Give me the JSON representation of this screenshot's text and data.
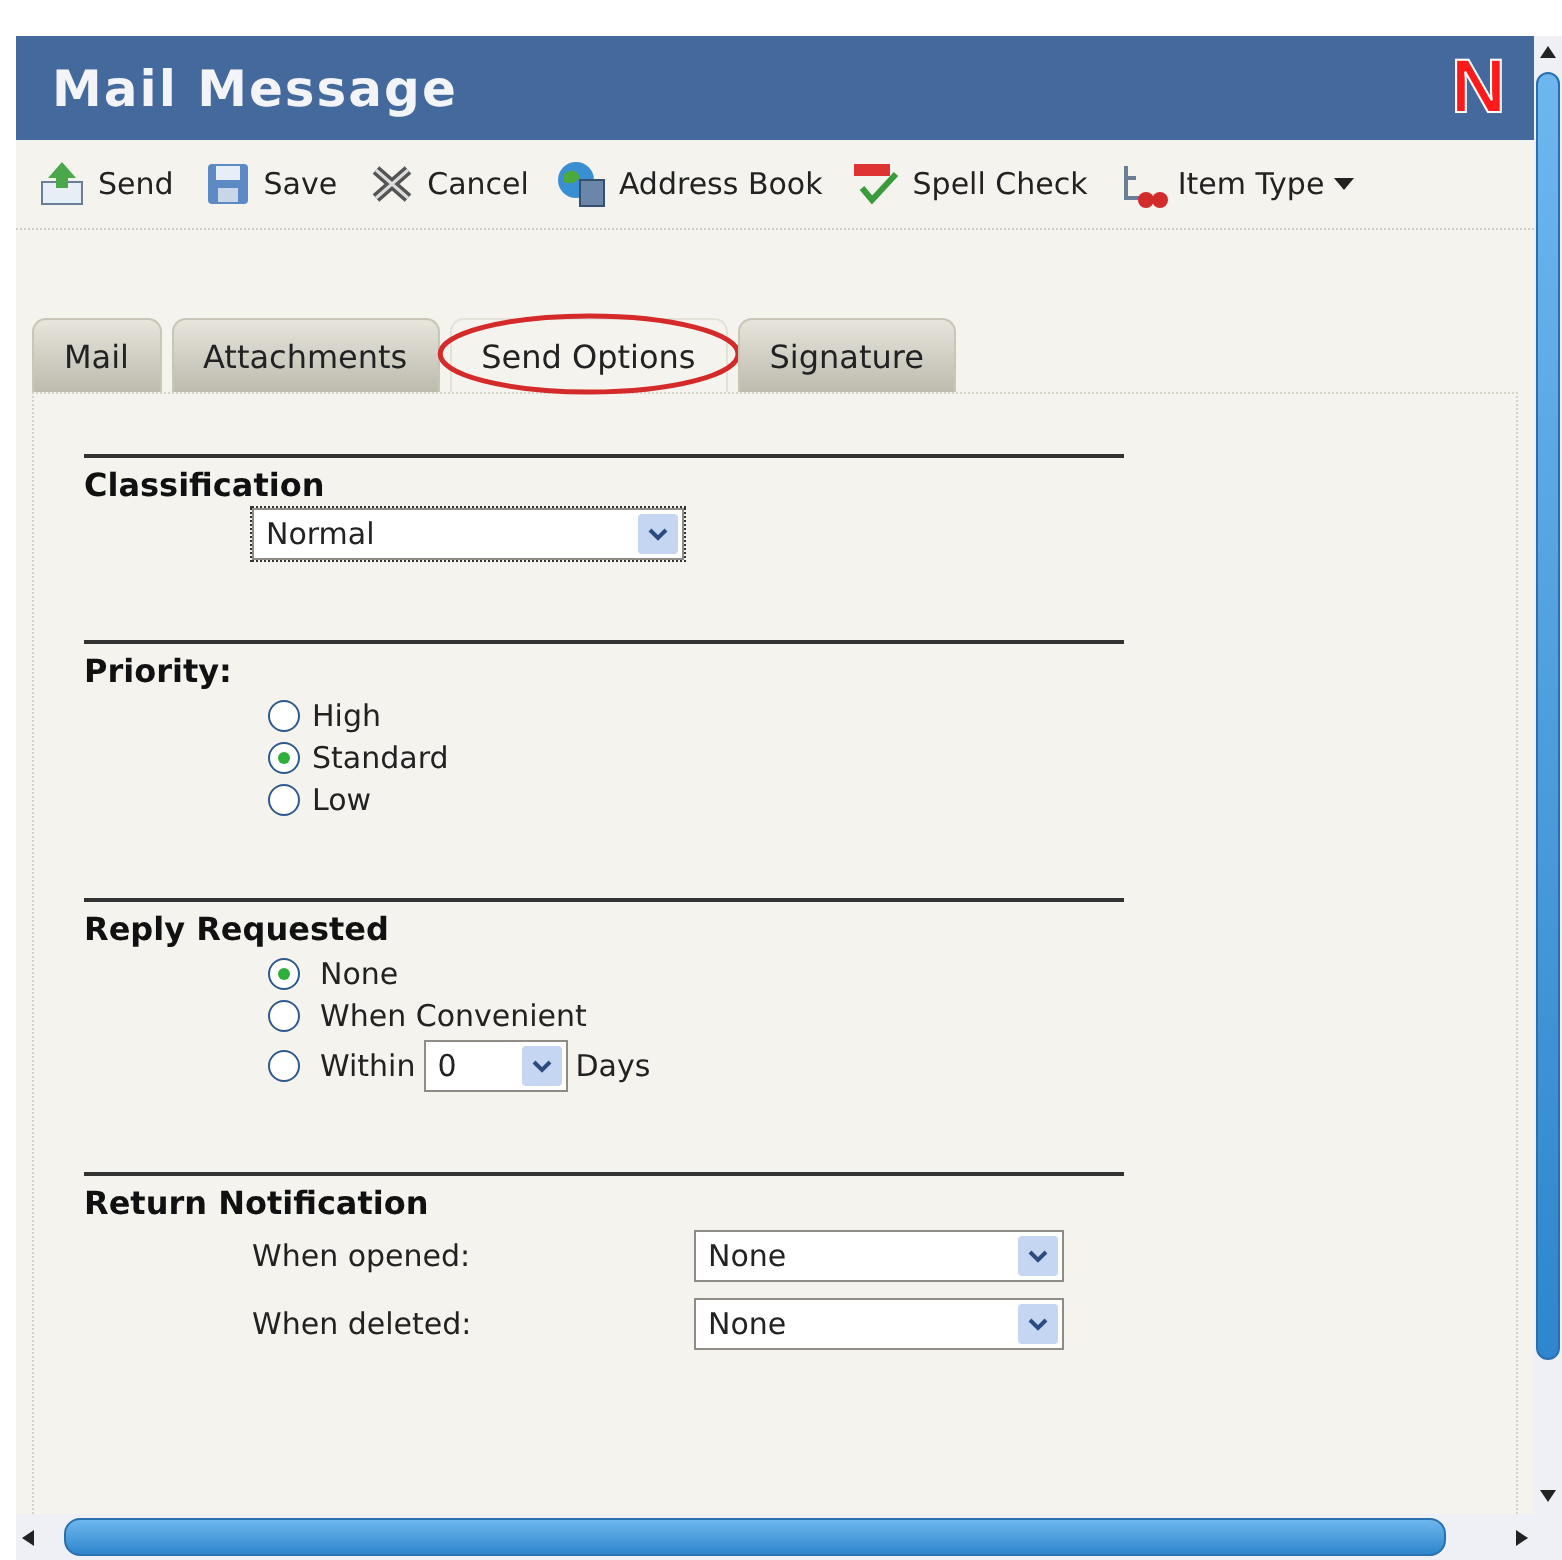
{
  "window": {
    "title": "Mail Message",
    "logo": "N"
  },
  "toolbar": [
    {
      "label": "Send",
      "kind": "send"
    },
    {
      "label": "Save",
      "kind": "save"
    },
    {
      "label": "Cancel",
      "kind": "cancel"
    },
    {
      "label": "Address Book",
      "kind": "book"
    },
    {
      "label": "Spell Check",
      "kind": "spell"
    },
    {
      "label": "Item Type",
      "kind": "type",
      "dropdown": true
    }
  ],
  "tabs": [
    {
      "label": "Mail",
      "selected": false,
      "circled": false
    },
    {
      "label": "Attachments",
      "selected": false,
      "circled": false
    },
    {
      "label": "Send Options",
      "selected": true,
      "circled": true
    },
    {
      "label": "Signature",
      "selected": false,
      "circled": false
    }
  ],
  "classification": {
    "title": "Classification",
    "value": "Normal"
  },
  "priority": {
    "title": "Priority:",
    "options": [
      {
        "label": "High",
        "selected": false
      },
      {
        "label": "Standard",
        "selected": true
      },
      {
        "label": "Low",
        "selected": false
      }
    ]
  },
  "reply_requested": {
    "title": "Reply Requested",
    "options": [
      {
        "label": "None",
        "selected": true,
        "kind": "plain"
      },
      {
        "label": "When Convenient",
        "selected": false,
        "kind": "plain"
      },
      {
        "label": "Within",
        "selected": false,
        "kind": "days",
        "value": "0",
        "suffix": "Days"
      }
    ]
  },
  "return_notification": {
    "title": "Return Notification",
    "rows": [
      {
        "label": "When opened:",
        "value": "None"
      },
      {
        "label": "When deleted:",
        "value": "None"
      }
    ]
  }
}
